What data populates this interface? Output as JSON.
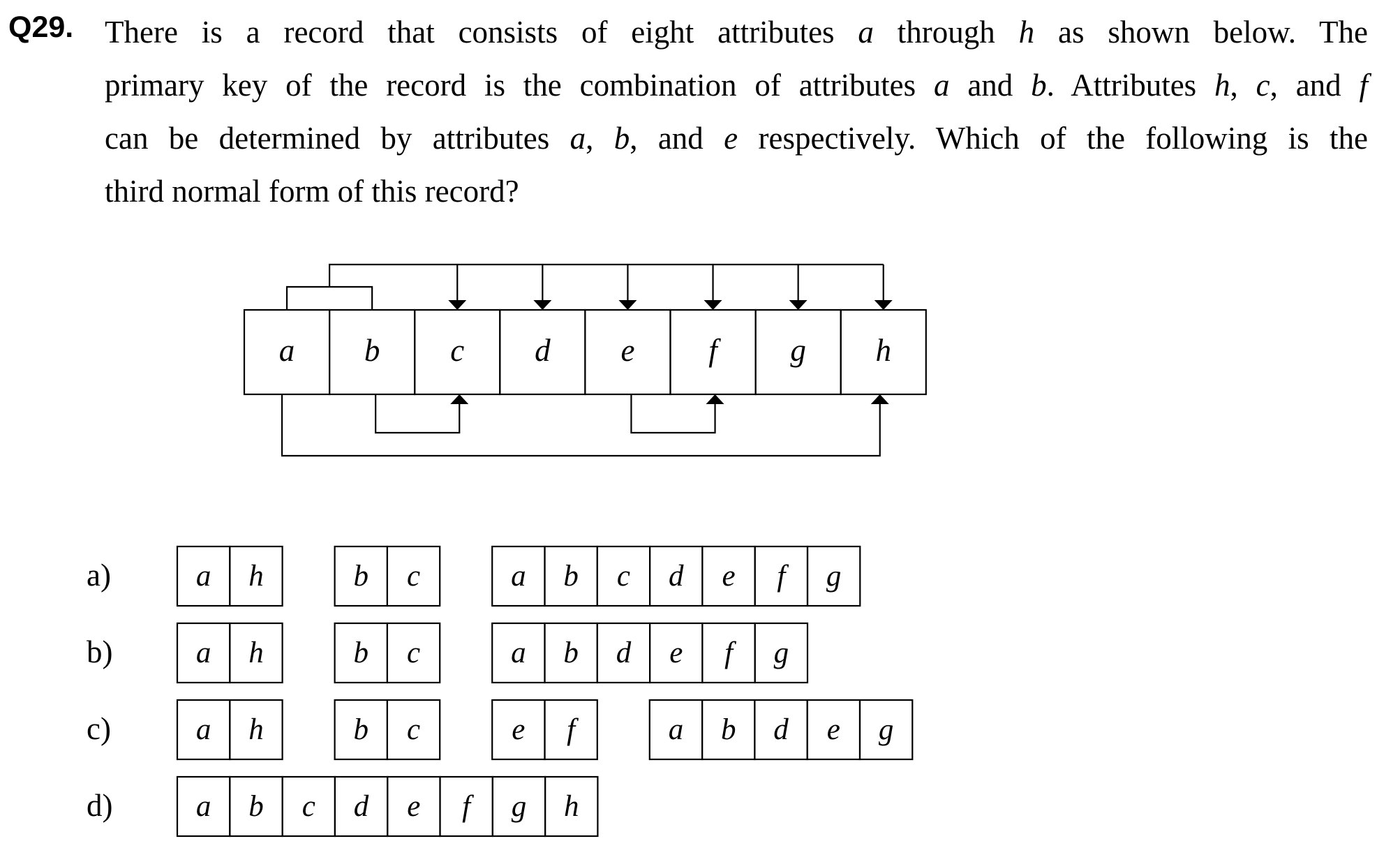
{
  "question": {
    "number": "Q29.",
    "lines": [
      [
        {
          "t": "There is a record that consists of eight attributes "
        },
        {
          "t": "a",
          "i": true
        },
        {
          "t": " through "
        },
        {
          "t": "h",
          "i": true
        },
        {
          "t": " as shown below. The"
        }
      ],
      [
        {
          "t": "primary key of the record is the combination of attributes "
        },
        {
          "t": "a",
          "i": true
        },
        {
          "t": " and "
        },
        {
          "t": "b",
          "i": true
        },
        {
          "t": ". Attributes "
        },
        {
          "t": "h",
          "i": true
        },
        {
          "t": ", "
        },
        {
          "t": "c",
          "i": true
        },
        {
          "t": ", and "
        },
        {
          "t": "f",
          "i": true
        }
      ],
      [
        {
          "t": "can be determined by attributes "
        },
        {
          "t": "a",
          "i": true
        },
        {
          "t": ", "
        },
        {
          "t": "b",
          "i": true
        },
        {
          "t": ", and "
        },
        {
          "t": "e",
          "i": true
        },
        {
          "t": " respectively.   Which of the following is the"
        }
      ],
      [
        {
          "t": "third normal form of this record?"
        }
      ]
    ]
  },
  "record": {
    "attributes": [
      "a",
      "b",
      "c",
      "d",
      "e",
      "f",
      "g",
      "h"
    ],
    "primary_key": [
      "a",
      "b"
    ],
    "key_determines": [
      "c",
      "d",
      "e",
      "f",
      "g",
      "h"
    ],
    "partial_dependencies": [
      {
        "from": "b",
        "to": "c"
      },
      {
        "from": "e",
        "to": "f"
      },
      {
        "from": "a",
        "to": "h"
      }
    ]
  },
  "choices": [
    {
      "label": "a)",
      "tables": [
        [
          "a",
          "h"
        ],
        [
          "b",
          "c"
        ],
        [
          "a",
          "b",
          "c",
          "d",
          "e",
          "f",
          "g"
        ]
      ]
    },
    {
      "label": "b)",
      "tables": [
        [
          "a",
          "h"
        ],
        [
          "b",
          "c"
        ],
        [
          "a",
          "b",
          "d",
          "e",
          "f",
          "g"
        ]
      ]
    },
    {
      "label": "c)",
      "tables": [
        [
          "a",
          "h"
        ],
        [
          "b",
          "c"
        ],
        [
          "e",
          "f"
        ],
        [
          "a",
          "b",
          "d",
          "e",
          "g"
        ]
      ]
    },
    {
      "label": "d)",
      "tables": [
        [
          "a",
          "b",
          "c",
          "d",
          "e",
          "f",
          "g",
          "h"
        ]
      ]
    }
  ]
}
